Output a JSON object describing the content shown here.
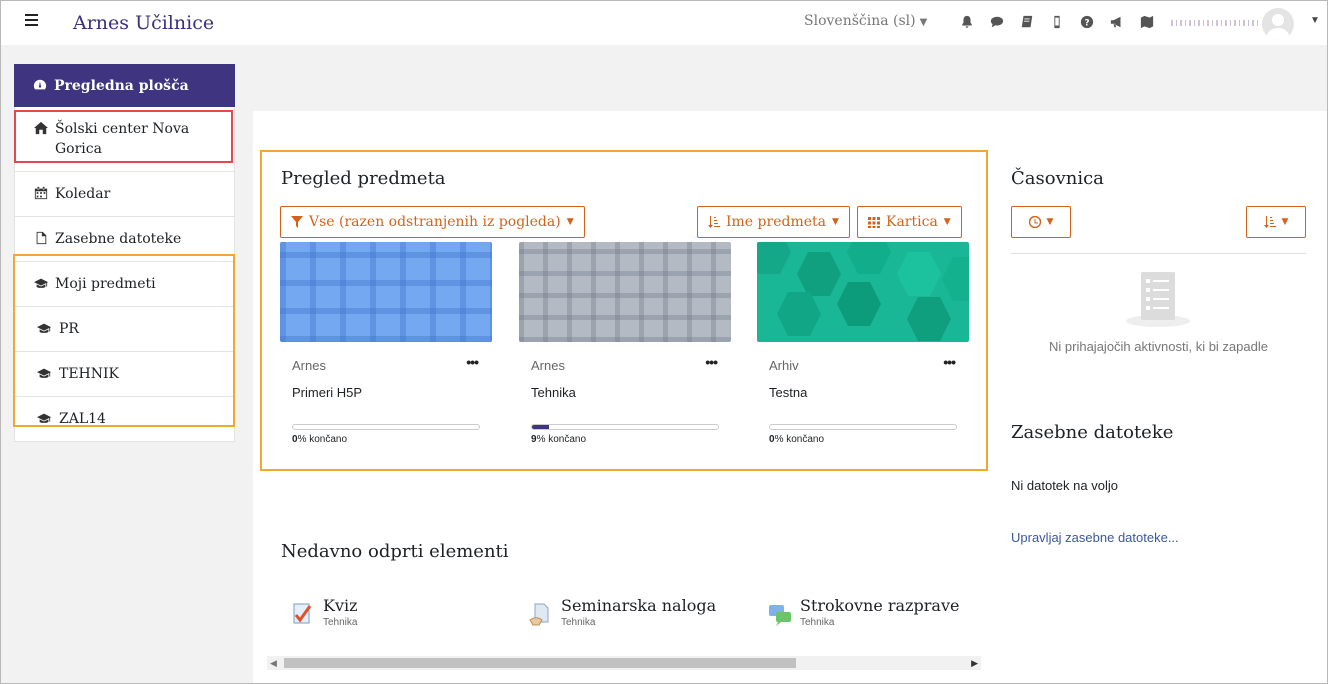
{
  "header": {
    "brand": "Arnes Učilnice",
    "language": "Slovenščina (sl)"
  },
  "icons": {
    "menu": "hamburger-icon",
    "notifications": "bell-icon",
    "messages": "chat-icon",
    "book": "book-icon",
    "mobile": "mobile-icon",
    "help": "question-icon",
    "announce": "megaphone-icon",
    "map": "map-icon"
  },
  "sidebar": {
    "items": [
      {
        "label": "Pregledna plošča",
        "icon": "dashboard-icon"
      },
      {
        "label": "Šolski center Nova Gorica",
        "icon": "home-icon"
      },
      {
        "label": "Koledar",
        "icon": "calendar-icon"
      },
      {
        "label": "Zasebne datoteke",
        "icon": "file-icon"
      },
      {
        "label": "Moji predmeti",
        "icon": "graduation-cap-icon"
      },
      {
        "label": "PR",
        "icon": "graduation-cap-icon"
      },
      {
        "label": "TEHNIK",
        "icon": "graduation-cap-icon"
      },
      {
        "label": "ZAL14",
        "icon": "graduation-cap-icon"
      }
    ]
  },
  "overview": {
    "title": "Pregled predmeta",
    "filter_label": "Vse (razen odstranjenih iz pogleda)",
    "sort_label": "Ime predmeta",
    "view_label": "Kartica",
    "courses": [
      {
        "category": "Arnes",
        "name": "Primeri H5P",
        "progress": 0,
        "progress_pct": "0",
        "progress_suffix": "% končano"
      },
      {
        "category": "Arnes",
        "name": "Tehnika",
        "progress": 9,
        "progress_pct": "9",
        "progress_suffix": "% končano"
      },
      {
        "category": "Arhiv",
        "name": "Testna",
        "progress": 0,
        "progress_pct": "0",
        "progress_suffix": "% končano"
      }
    ],
    "more_label": "•••"
  },
  "recent": {
    "title": "Nedavno odprti elementi",
    "items": [
      {
        "name": "Kviz",
        "course": "Tehnika",
        "icon": "quiz-icon"
      },
      {
        "name": "Seminarska naloga",
        "course": "Tehnika",
        "icon": "assignment-icon"
      },
      {
        "name": "Strokovne razprave",
        "course": "Tehnika",
        "icon": "forum-icon"
      }
    ]
  },
  "timeline": {
    "title": "Časovnica",
    "empty_text": "Ni prihajajočih aktivnosti, ki bi zapadle"
  },
  "private_files": {
    "title": "Zasebne datoteke",
    "empty_text": "Ni datotek na voljo",
    "manage_link": "Upravljaj zasebne datoteke..."
  },
  "colors": {
    "brand": "#3b2f7e",
    "accent": "#d3631a",
    "active_nav": "#3e3480",
    "highlight_orange": "#f0a830",
    "highlight_red": "#e8464f"
  }
}
